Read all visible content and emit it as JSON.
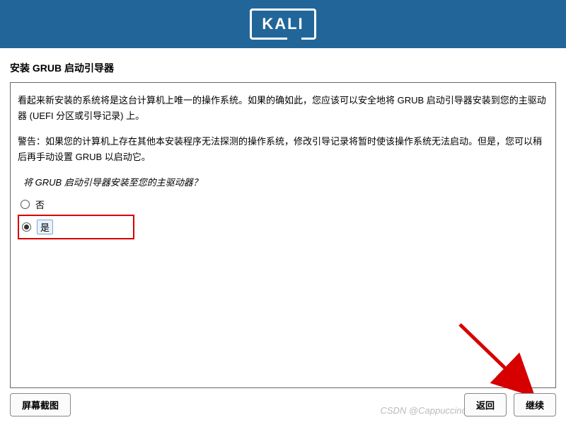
{
  "header": {
    "logo": "KALI"
  },
  "section_title": "安装 GRUB 启动引导器",
  "body": {
    "p1": "看起来新安装的系统将是这台计算机上唯一的操作系统。如果的确如此，您应该可以安全地将 GRUB 启动引导器安装到您的主驱动器 (UEFI 分区或引导记录) 上。",
    "p2": "警告：如果您的计算机上存在其他本安装程序无法探测的操作系统，修改引导记录将暂时使该操作系统无法启动。但是，您可以稍后再手动设置 GRUB 以启动它。",
    "question": "将 GRUB 启动引导器安装至您的主驱动器？"
  },
  "options": {
    "no": "否",
    "yes": "是"
  },
  "buttons": {
    "screenshot": "屏幕截图",
    "back": "返回",
    "continue": "继续"
  },
  "watermark": "CSDN @Cappuccino.jay"
}
